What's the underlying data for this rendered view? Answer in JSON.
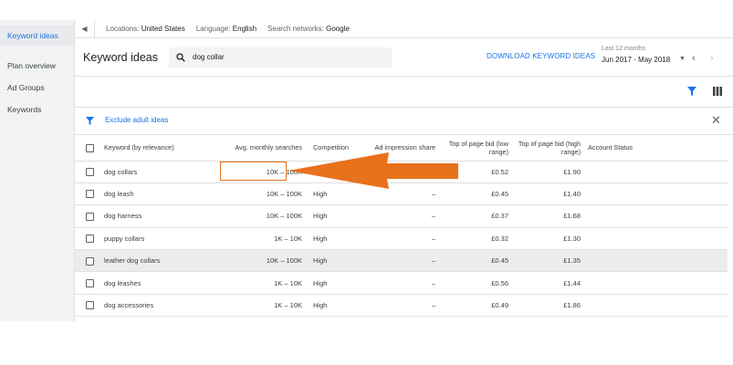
{
  "sidebar": {
    "items": [
      {
        "label": "Keyword ideas",
        "active": true
      },
      {
        "label": "Plan overview",
        "active": false
      },
      {
        "label": "Ad Groups",
        "active": false
      },
      {
        "label": "Keywords",
        "active": false
      }
    ]
  },
  "filters": {
    "locations_label": "Locations:",
    "locations_value": "United States",
    "language_label": "Language:",
    "language_value": "English",
    "networks_label": "Search networks:",
    "networks_value": "Google"
  },
  "header": {
    "title": "Keyword ideas",
    "search_value": "dog collar",
    "download_label": "DOWNLOAD KEYWORD IDEAS",
    "range_label": "Last 12 months",
    "range_value": "Jun 2017 - May 2018"
  },
  "adult_filter": {
    "label": "Exclude adult ideas"
  },
  "table": {
    "headers": {
      "keyword": "Keyword (by relevance)",
      "avg": "Avg. monthly searches",
      "competition": "Competition",
      "impression": "Ad impression share",
      "low_bid": "Top of page bid (low range)",
      "high_bid": "Top of page bid (high range)",
      "status": "Account Status"
    },
    "rows": [
      {
        "keyword": "dog collars",
        "avg": "10K – 100K",
        "competition": "High",
        "impression": "",
        "low_bid": "£0.52",
        "high_bid": "£1.90"
      },
      {
        "keyword": "dog leash",
        "avg": "10K – 100K",
        "competition": "High",
        "impression": "–",
        "low_bid": "£0.45",
        "high_bid": "£1.40"
      },
      {
        "keyword": "dog harness",
        "avg": "10K – 100K",
        "competition": "High",
        "impression": "–",
        "low_bid": "£0.37",
        "high_bid": "£1.68"
      },
      {
        "keyword": "puppy collars",
        "avg": "1K – 10K",
        "competition": "High",
        "impression": "–",
        "low_bid": "£0.32",
        "high_bid": "£1.30"
      },
      {
        "keyword": "leather dog collars",
        "avg": "10K – 100K",
        "competition": "High",
        "impression": "–",
        "low_bid": "£0.45",
        "high_bid": "£1.35"
      },
      {
        "keyword": "dog leashes",
        "avg": "1K – 10K",
        "competition": "High",
        "impression": "–",
        "low_bid": "£0.56",
        "high_bid": "£1.44"
      },
      {
        "keyword": "dog accessories",
        "avg": "1K – 10K",
        "competition": "High",
        "impression": "–",
        "low_bid": "£0.49",
        "high_bid": "£1.86"
      }
    ]
  },
  "colors": {
    "accent": "#1a73e8",
    "annotation": "#e8711c"
  }
}
